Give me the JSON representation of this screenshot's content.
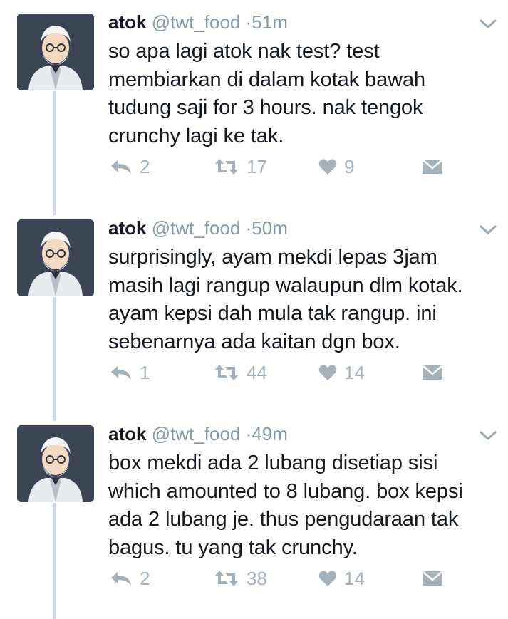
{
  "tweets": [
    {
      "name": "atok",
      "handle": "@twt_food",
      "separator": "·",
      "time": "51m",
      "text": "so apa lagi atok nak test? test membiarkan di dalam kotak bawah tudung saji for 3 hours. nak tengok crunchy lagi ke tak.",
      "replies": "2",
      "retweets": "17",
      "likes": "9"
    },
    {
      "name": "atok",
      "handle": "@twt_food",
      "separator": "·",
      "time": "50m",
      "text": "surprisingly, ayam mekdi lepas 3jam masih lagi rangup walaupun dlm kotak. ayam kepsi dah mula tak rangup. ini sebenarnya ada kaitan dgn box.",
      "replies": "1",
      "retweets": "44",
      "likes": "14"
    },
    {
      "name": "atok",
      "handle": "@twt_food",
      "separator": "·",
      "time": "49m",
      "text": "box mekdi ada 2 lubang disetiap sisi which amounted to 8 lubang. box kepsi ada 2 lubang je. thus pengudaraan tak bagus. tu yang tak crunchy.",
      "replies": "2",
      "retweets": "38",
      "likes": "14"
    }
  ],
  "icons": {
    "reply": "reply-arrow-icon",
    "retweet": "retweet-icon",
    "like": "heart-icon",
    "message": "envelope-icon",
    "menu": "chevron-down-icon"
  },
  "colors": {
    "text": "#141823",
    "secondary": "#8899a6",
    "action": "#a3b1bd",
    "thread_line": "#d4dbe2"
  }
}
